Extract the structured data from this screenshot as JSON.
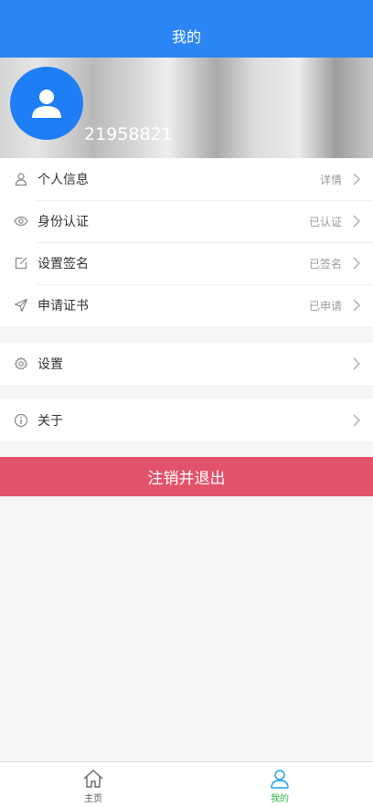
{
  "header": {
    "title": "我的"
  },
  "profile": {
    "user_id": "21958821"
  },
  "menu": {
    "group1": [
      {
        "label": "个人信息",
        "value": "详情",
        "icon": "user-icon"
      },
      {
        "label": "身份认证",
        "value": "已认证",
        "icon": "eye-icon"
      },
      {
        "label": "设置签名",
        "value": "已签名",
        "icon": "edit-icon"
      },
      {
        "label": "申请证书",
        "value": "已申请",
        "icon": "send-icon"
      }
    ],
    "settings": {
      "label": "设置",
      "icon": "gear-icon"
    },
    "about": {
      "label": "关于",
      "icon": "info-icon"
    }
  },
  "logout_label": "注销并退出",
  "tabbar": {
    "home_label": "主页",
    "mine_label": "我的"
  },
  "colors": {
    "header": "#2b86f5",
    "avatar": "#1e7ef5",
    "logout": "#e3526b",
    "tab_active": "#19a3e8"
  }
}
